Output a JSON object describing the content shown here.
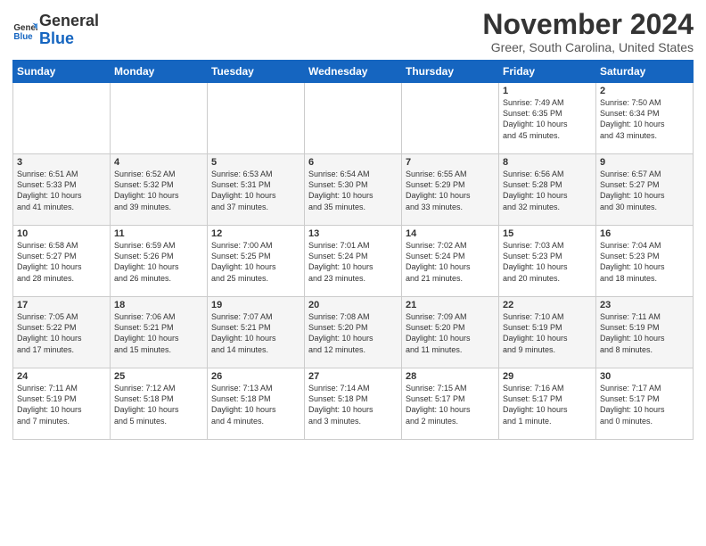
{
  "header": {
    "logo_general": "General",
    "logo_blue": "Blue",
    "month_title": "November 2024",
    "location": "Greer, South Carolina, United States"
  },
  "weekdays": [
    "Sunday",
    "Monday",
    "Tuesday",
    "Wednesday",
    "Thursday",
    "Friday",
    "Saturday"
  ],
  "weeks": [
    [
      {
        "day": "",
        "info": ""
      },
      {
        "day": "",
        "info": ""
      },
      {
        "day": "",
        "info": ""
      },
      {
        "day": "",
        "info": ""
      },
      {
        "day": "",
        "info": ""
      },
      {
        "day": "1",
        "info": "Sunrise: 7:49 AM\nSunset: 6:35 PM\nDaylight: 10 hours\nand 45 minutes."
      },
      {
        "day": "2",
        "info": "Sunrise: 7:50 AM\nSunset: 6:34 PM\nDaylight: 10 hours\nand 43 minutes."
      }
    ],
    [
      {
        "day": "3",
        "info": "Sunrise: 6:51 AM\nSunset: 5:33 PM\nDaylight: 10 hours\nand 41 minutes."
      },
      {
        "day": "4",
        "info": "Sunrise: 6:52 AM\nSunset: 5:32 PM\nDaylight: 10 hours\nand 39 minutes."
      },
      {
        "day": "5",
        "info": "Sunrise: 6:53 AM\nSunset: 5:31 PM\nDaylight: 10 hours\nand 37 minutes."
      },
      {
        "day": "6",
        "info": "Sunrise: 6:54 AM\nSunset: 5:30 PM\nDaylight: 10 hours\nand 35 minutes."
      },
      {
        "day": "7",
        "info": "Sunrise: 6:55 AM\nSunset: 5:29 PM\nDaylight: 10 hours\nand 33 minutes."
      },
      {
        "day": "8",
        "info": "Sunrise: 6:56 AM\nSunset: 5:28 PM\nDaylight: 10 hours\nand 32 minutes."
      },
      {
        "day": "9",
        "info": "Sunrise: 6:57 AM\nSunset: 5:27 PM\nDaylight: 10 hours\nand 30 minutes."
      }
    ],
    [
      {
        "day": "10",
        "info": "Sunrise: 6:58 AM\nSunset: 5:27 PM\nDaylight: 10 hours\nand 28 minutes."
      },
      {
        "day": "11",
        "info": "Sunrise: 6:59 AM\nSunset: 5:26 PM\nDaylight: 10 hours\nand 26 minutes."
      },
      {
        "day": "12",
        "info": "Sunrise: 7:00 AM\nSunset: 5:25 PM\nDaylight: 10 hours\nand 25 minutes."
      },
      {
        "day": "13",
        "info": "Sunrise: 7:01 AM\nSunset: 5:24 PM\nDaylight: 10 hours\nand 23 minutes."
      },
      {
        "day": "14",
        "info": "Sunrise: 7:02 AM\nSunset: 5:24 PM\nDaylight: 10 hours\nand 21 minutes."
      },
      {
        "day": "15",
        "info": "Sunrise: 7:03 AM\nSunset: 5:23 PM\nDaylight: 10 hours\nand 20 minutes."
      },
      {
        "day": "16",
        "info": "Sunrise: 7:04 AM\nSunset: 5:23 PM\nDaylight: 10 hours\nand 18 minutes."
      }
    ],
    [
      {
        "day": "17",
        "info": "Sunrise: 7:05 AM\nSunset: 5:22 PM\nDaylight: 10 hours\nand 17 minutes."
      },
      {
        "day": "18",
        "info": "Sunrise: 7:06 AM\nSunset: 5:21 PM\nDaylight: 10 hours\nand 15 minutes."
      },
      {
        "day": "19",
        "info": "Sunrise: 7:07 AM\nSunset: 5:21 PM\nDaylight: 10 hours\nand 14 minutes."
      },
      {
        "day": "20",
        "info": "Sunrise: 7:08 AM\nSunset: 5:20 PM\nDaylight: 10 hours\nand 12 minutes."
      },
      {
        "day": "21",
        "info": "Sunrise: 7:09 AM\nSunset: 5:20 PM\nDaylight: 10 hours\nand 11 minutes."
      },
      {
        "day": "22",
        "info": "Sunrise: 7:10 AM\nSunset: 5:19 PM\nDaylight: 10 hours\nand 9 minutes."
      },
      {
        "day": "23",
        "info": "Sunrise: 7:11 AM\nSunset: 5:19 PM\nDaylight: 10 hours\nand 8 minutes."
      }
    ],
    [
      {
        "day": "24",
        "info": "Sunrise: 7:11 AM\nSunset: 5:19 PM\nDaylight: 10 hours\nand 7 minutes."
      },
      {
        "day": "25",
        "info": "Sunrise: 7:12 AM\nSunset: 5:18 PM\nDaylight: 10 hours\nand 5 minutes."
      },
      {
        "day": "26",
        "info": "Sunrise: 7:13 AM\nSunset: 5:18 PM\nDaylight: 10 hours\nand 4 minutes."
      },
      {
        "day": "27",
        "info": "Sunrise: 7:14 AM\nSunset: 5:18 PM\nDaylight: 10 hours\nand 3 minutes."
      },
      {
        "day": "28",
        "info": "Sunrise: 7:15 AM\nSunset: 5:17 PM\nDaylight: 10 hours\nand 2 minutes."
      },
      {
        "day": "29",
        "info": "Sunrise: 7:16 AM\nSunset: 5:17 PM\nDaylight: 10 hours\nand 1 minute."
      },
      {
        "day": "30",
        "info": "Sunrise: 7:17 AM\nSunset: 5:17 PM\nDaylight: 10 hours\nand 0 minutes."
      }
    ]
  ]
}
